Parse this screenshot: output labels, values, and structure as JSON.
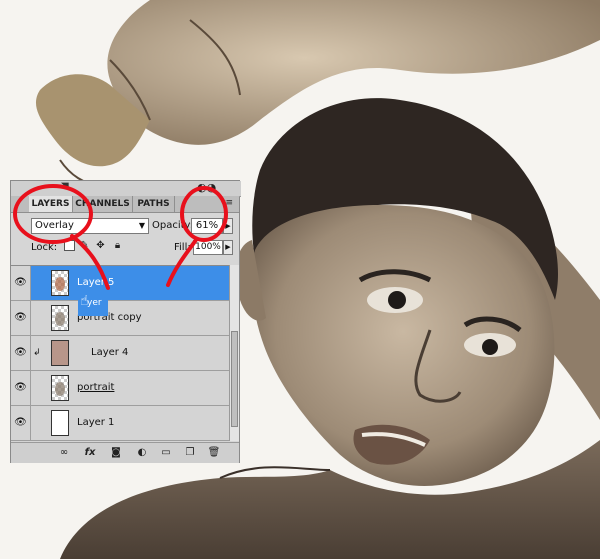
{
  "panel": {
    "tabs": [
      "LAYERS",
      "CHANNELS",
      "PATHS"
    ],
    "blend_mode": "Overlay",
    "opacity_label": "Opacity:",
    "opacity_value": "61%",
    "lock_label": "Lock:",
    "fill_label": "Fill:",
    "fill_value": "100%"
  },
  "layers": [
    {
      "name": "Layer 5",
      "selected": true,
      "thumb": "checker-face"
    },
    {
      "name": "portrait copy",
      "selected": false,
      "thumb": "checker-face"
    },
    {
      "name": "Layer 4",
      "selected": false,
      "thumb": "brown",
      "clipped": true
    },
    {
      "name": "portrait",
      "selected": false,
      "thumb": "checker-face",
      "underlined": true
    },
    {
      "name": "Layer 1",
      "selected": false,
      "thumb": "white"
    }
  ],
  "drag_ghost_label": "yer",
  "icons": {
    "eye": "eye-icon",
    "clip": "clip-arrow-icon",
    "lock": [
      "lock-transparent-icon",
      "lock-pixels-icon",
      "lock-position-icon",
      "lock-all-icon"
    ],
    "footer": [
      "link-layers-icon",
      "fx-icon",
      "add-mask-icon",
      "adjustment-layer-icon",
      "new-group-icon",
      "new-layer-icon",
      "delete-layer-icon"
    ]
  },
  "colors": {
    "selection": "#3d8ee8",
    "annotation": "#e8101c",
    "panel": "#d6d6d6"
  }
}
